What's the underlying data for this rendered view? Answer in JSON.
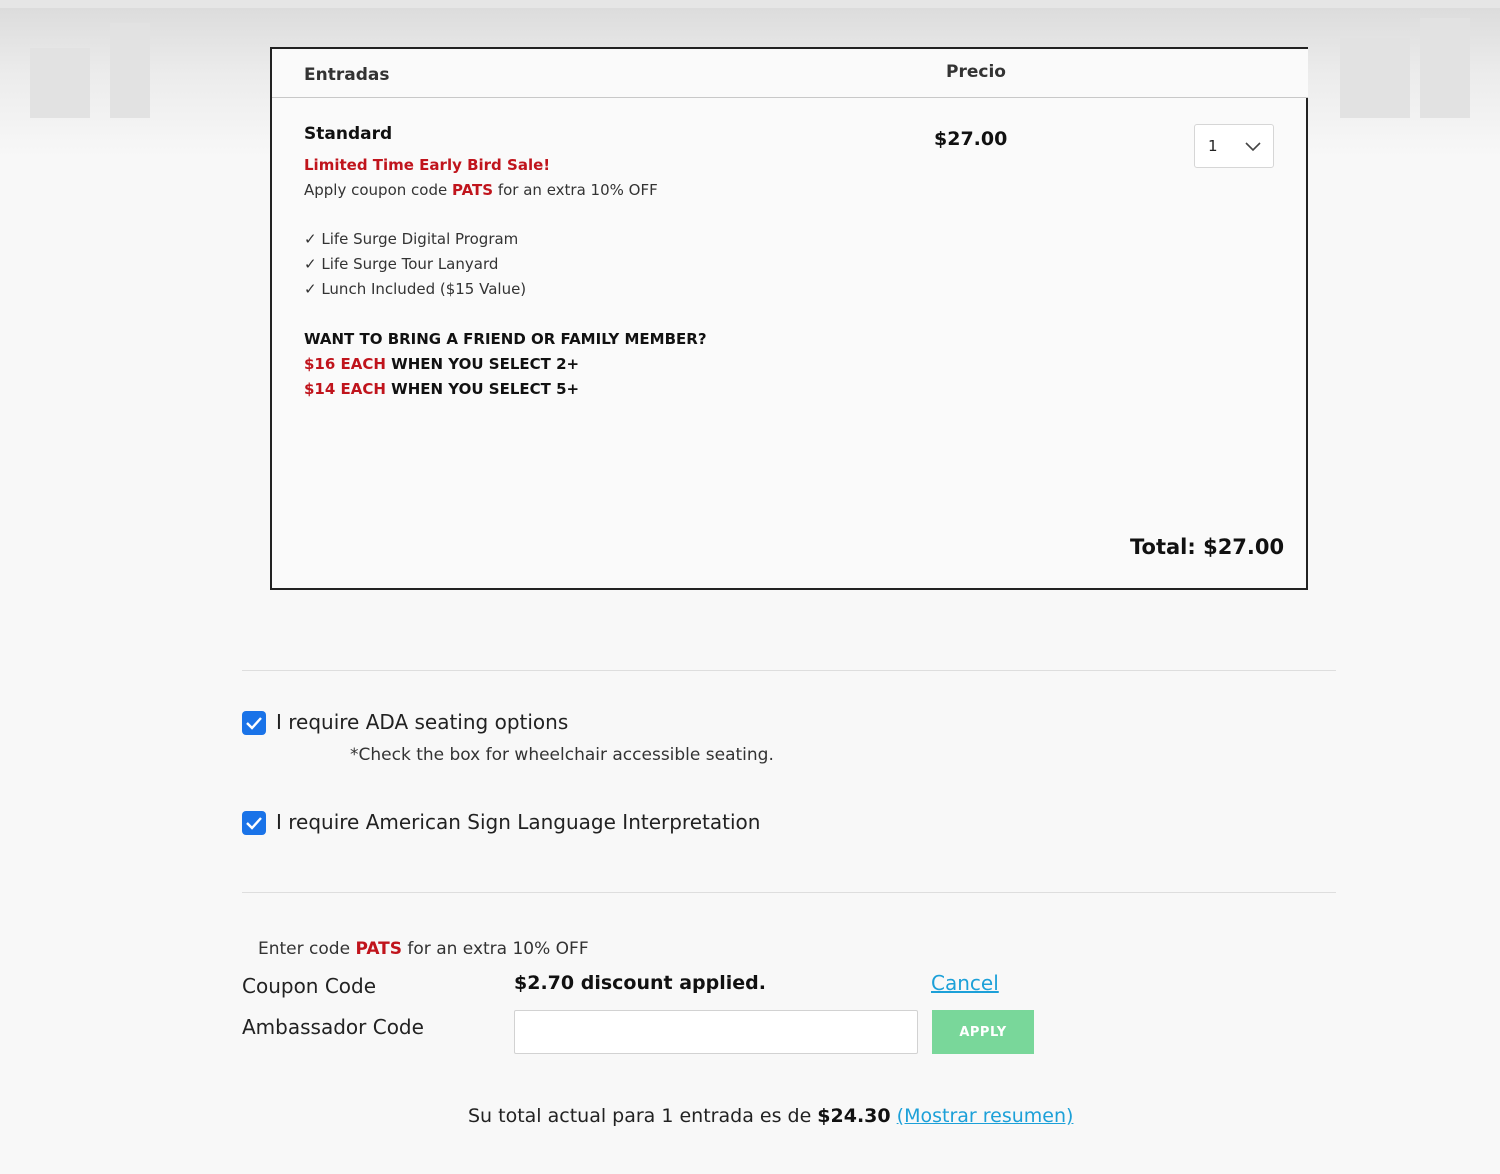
{
  "table": {
    "col_entradas": "Entradas",
    "col_precio": "Precio"
  },
  "ticket": {
    "name": "Standard",
    "price": "$27.00",
    "quantity": "1",
    "sale_text": "Limited Time Early Bird Sale!",
    "coupon_pre": "Apply coupon code ",
    "coupon_code": "PATS",
    "coupon_post": " for an extra 10% OFF",
    "benefits": [
      "✓ Life Surge Digital Program",
      "✓ Life Surge Tour Lanyard",
      "✓ Lunch Included ($15 Value)"
    ],
    "promo_title": "WANT TO BRING A FRIEND OR FAMILY MEMBER?",
    "promo_1_red": "$16 EACH",
    "promo_1_rest": " WHEN YOU SELECT 2+",
    "promo_2_red": "$14 EACH",
    "promo_2_rest": " WHEN YOU SELECT 5+"
  },
  "total_label": "Total: $27.00",
  "options": {
    "ada_label": "I require ADA seating options",
    "ada_checked": true,
    "ada_note": "*Check the box for wheelchair accessible seating.",
    "asl_label": "I require American Sign Language Interpretation",
    "asl_checked": true
  },
  "coupon": {
    "hint_pre": "Enter code ",
    "hint_code": "PATS",
    "hint_post": " for an extra 10% OFF",
    "coupon_label": "Coupon Code",
    "discount_text": "$2.70 discount applied.",
    "cancel_label": "Cancel",
    "ambassador_label": "Ambassador Code",
    "ambassador_value": "",
    "apply_label": "APPLY"
  },
  "summary": {
    "pre": "Su total actual para 1 entrada es de ",
    "amount": "$24.30",
    "link": "(Mostrar resumen)"
  },
  "colors": {
    "accent_red": "#c0141c",
    "checkbox_blue": "#1a73e8",
    "link_blue": "#1ca0d8",
    "apply_green": "#79d79a"
  }
}
